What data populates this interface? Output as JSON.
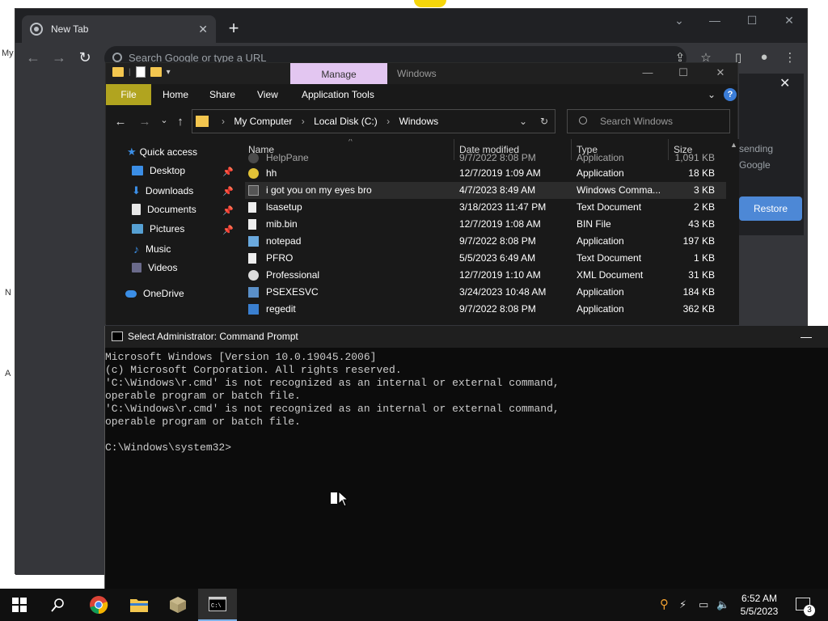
{
  "desktop": {
    "fragments": [
      "My",
      "N",
      "A"
    ]
  },
  "chrome": {
    "tab_title": "New Tab",
    "omnibox_placeholder": "Search Google or type a URL",
    "side_text_1": "sending",
    "side_text_2": "Google",
    "restore_label": "Restore"
  },
  "explorer": {
    "manage_label": "Manage",
    "window_title": "Windows",
    "ribbon_tabs": [
      "File",
      "Home",
      "Share",
      "View",
      "Application Tools"
    ],
    "breadcrumb": [
      "My Computer",
      "Local Disk (C:)",
      "Windows"
    ],
    "search_placeholder": "Search Windows",
    "nav": [
      {
        "label": "Quick access",
        "pinned": false
      },
      {
        "label": "Desktop",
        "pinned": true
      },
      {
        "label": "Downloads",
        "pinned": true
      },
      {
        "label": "Documents",
        "pinned": true
      },
      {
        "label": "Pictures",
        "pinned": true
      },
      {
        "label": "Music",
        "pinned": false
      },
      {
        "label": "Videos",
        "pinned": false
      },
      {
        "label": "OneDrive",
        "pinned": false
      }
    ],
    "columns": [
      "Name",
      "Date modified",
      "Type",
      "Size"
    ],
    "rows": [
      {
        "name": "HelpPane",
        "date": "9/7/2022 8:08 PM",
        "type": "Application",
        "size": "1,091 KB"
      },
      {
        "name": "hh",
        "date": "12/7/2019 1:09 AM",
        "type": "Application",
        "size": "18 KB"
      },
      {
        "name": "i got you on my eyes bro",
        "date": "4/7/2023 8:49 AM",
        "type": "Windows Comma...",
        "size": "3 KB"
      },
      {
        "name": "lsasetup",
        "date": "3/18/2023 11:47 PM",
        "type": "Text Document",
        "size": "2 KB"
      },
      {
        "name": "mib.bin",
        "date": "12/7/2019 1:08 AM",
        "type": "BIN File",
        "size": "43 KB"
      },
      {
        "name": "notepad",
        "date": "9/7/2022 8:08 PM",
        "type": "Application",
        "size": "197 KB"
      },
      {
        "name": "PFRO",
        "date": "5/5/2023 6:49 AM",
        "type": "Text Document",
        "size": "1 KB"
      },
      {
        "name": "Professional",
        "date": "12/7/2019 1:10 AM",
        "type": "XML Document",
        "size": "31 KB"
      },
      {
        "name": "PSEXESVC",
        "date": "3/24/2023 10:48 AM",
        "type": "Application",
        "size": "184 KB"
      },
      {
        "name": "regedit",
        "date": "9/7/2022 8:08 PM",
        "type": "Application",
        "size": "362 KB"
      }
    ]
  },
  "cmd": {
    "title": "Select Administrator: Command Prompt",
    "lines": "Microsoft Windows [Version 10.0.19045.2006]\n(c) Microsoft Corporation. All rights reserved.\n'C:\\Windows\\r.cmd' is not recognized as an internal or external command,\noperable program or batch file.\n'C:\\Windows\\r.cmd' is not recognized as an internal or external command,\noperable program or batch file.\n\nC:\\Windows\\system32>"
  },
  "taskbar": {
    "time": "6:52 AM",
    "date": "5/5/2023",
    "notification_count": "3"
  }
}
